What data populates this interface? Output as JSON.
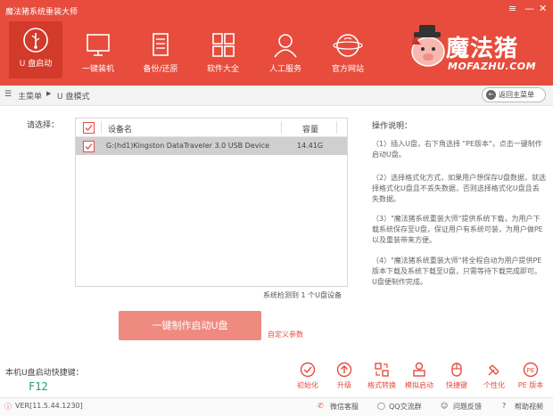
{
  "app": {
    "title": "魔法猪系统重装大师"
  },
  "nav": [
    {
      "label": "U 盘启动",
      "icon": "usb-icon"
    },
    {
      "label": "一键装机",
      "icon": "monitor-icon"
    },
    {
      "label": "备份/还原",
      "icon": "document-icon"
    },
    {
      "label": "软件大全",
      "icon": "grid-icon"
    },
    {
      "label": "人工服务",
      "icon": "user-icon"
    },
    {
      "label": "官方网站",
      "icon": "globe-icon"
    }
  ],
  "logo": {
    "text": "魔法猪",
    "sub": "MOFAZHU.COM"
  },
  "breadcrumb": {
    "menu": "主菜单",
    "sep": "▶",
    "current": "U 盘模式"
  },
  "back_label": "返回主菜单",
  "select_label": "请选择：",
  "table": {
    "headers": {
      "device": "设备名",
      "capacity": "容量"
    },
    "rows": [
      {
        "device": "G:(hd1)Kingston DataTraveler 3.0 USB Device",
        "capacity": "14.41G",
        "checked": true
      }
    ]
  },
  "status": "系统检测到 1 个U盘设备",
  "instructions": {
    "title": "操作说明：",
    "steps": [
      "（1）插入U盘，右下角选择 \"PE版本\"，点击一键制作启动U盘。",
      "（2）选择格式化方式，如果用户想保存U盘数据，就选择格式化U盘且不丢失数据，否则选择格式化U盘且丢失数据。",
      "（3）\"魔法猪系统重装大师\"提供系统下载，为用户下载系统保存至U盘，保证用户有系统可装，为用户做PE以及重装带来方便。",
      "（4）\"魔法猪系统重装大师\"将全程自动为用户提供PE版本下载及系统下载至U盘，只需等待下载完成即可。U盘便制作完成。"
    ]
  },
  "make_button": "一键制作启动U盘",
  "custom_params": "自定义参数",
  "hotkey": {
    "label": "本机U盘启动快捷键：",
    "key": "F12"
  },
  "tools": [
    {
      "label": "初始化",
      "icon": "check-circle-icon"
    },
    {
      "label": "升级",
      "icon": "upgrade-icon"
    },
    {
      "label": "格式转换",
      "icon": "convert-icon"
    },
    {
      "label": "模拟启动",
      "icon": "simulate-icon"
    },
    {
      "label": "快捷键",
      "icon": "mouse-icon"
    },
    {
      "label": "个性化",
      "icon": "brush-icon"
    },
    {
      "label": "PE 版本",
      "icon": "pe-icon"
    }
  ],
  "footer": {
    "version": "VER[11.5.44.1230]",
    "wechat": "微信客服",
    "qq": "QQ交流群",
    "feedback": "问题反馈",
    "help": "帮助视频"
  },
  "colors": {
    "brand": "#e74c3c",
    "hotkey": "#1f9b6a"
  }
}
